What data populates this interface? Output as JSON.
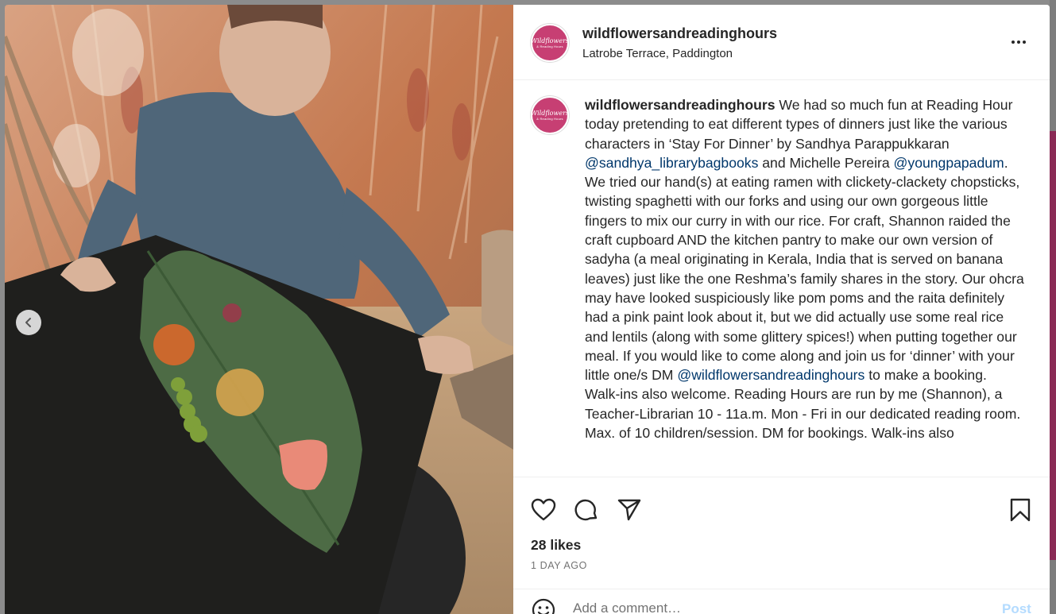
{
  "post": {
    "username": "wildflowersandreadinghours",
    "location": "Latrobe Terrace, Paddington",
    "avatar_text_line1": "Wildflowers",
    "avatar_text_line2": "& Reading Hours",
    "caption_segments": [
      {
        "type": "text",
        "text": " We had so much fun at Reading Hour today pretending to eat different types of dinners just like the various characters in ‘Stay For Dinner’ by Sandhya Parappukkaran "
      },
      {
        "type": "mention",
        "text": "@sandhya_librarybagbooks"
      },
      {
        "type": "text",
        "text": " and Michelle Pereira "
      },
      {
        "type": "mention",
        "text": "@youngpapadum"
      },
      {
        "type": "text",
        "text": ". We tried our hand(s) at eating ramen with clickety-clackety chopsticks, twisting spaghetti with our forks and using our own gorgeous little fingers to mix our curry in with our rice. For craft, Shannon raided the craft cupboard AND the kitchen pantry to make our own version of sadyha (a meal originating in Kerala, India that is served on banana leaves) just like the one Reshma’s family shares in the story. Our ohcra may have looked suspiciously like pom poms and the raita definitely had a pink paint look about it, but we did actually use some real rice and lentils (along with some glittery spices!) when putting together our meal. If you would like to come along and join us for ‘dinner’ with your little one/s DM "
      },
      {
        "type": "mention",
        "text": "@wildflowersandreadinghours"
      },
      {
        "type": "text",
        "text": " to make a booking. Walk-ins also welcome. Reading Hours are run by me (Shannon), a Teacher-Librarian 10 - 11a.m. Mon - Fri in our dedicated reading room. Max. of 10 children/session. DM for bookings. Walk-ins also"
      }
    ],
    "likes": "28 likes",
    "time_ago": "1 DAY AGO"
  },
  "comment": {
    "placeholder": "Add a comment…",
    "post_label": "Post"
  },
  "icons": {
    "like": "heart-icon",
    "comment": "comment-icon",
    "share": "paper-plane-icon",
    "save": "bookmark-icon",
    "more": "more-options-icon",
    "emoji": "emoji-icon",
    "prev": "chevron-left-icon"
  },
  "colors": {
    "brand_avatar": "#c73f73",
    "mention_link": "#00376b",
    "post_button_disabled": "#b3dbff"
  }
}
